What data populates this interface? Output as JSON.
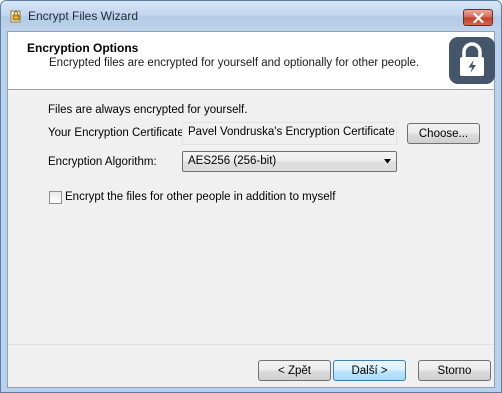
{
  "window": {
    "title": "Encrypt Files Wizard",
    "icons": {
      "app": "encrypt-wizard-icon",
      "close": "close-icon"
    }
  },
  "header": {
    "title": "Encryption Options",
    "subtitle": "Encrypted files are encrypted for yourself and optionally for other people.",
    "icon": "lock-icon"
  },
  "form": {
    "note": "Files are always encrypted for yourself.",
    "certificate_label": "Your Encryption Certificate:",
    "certificate_value": "Pavel Vondruska's Encryption Certificate",
    "choose_label": "Choose...",
    "algorithm_label": "Encryption Algorithm:",
    "algorithm_value": "AES256 (256-bit)",
    "others_checkbox_label": "Encrypt the files for other people in addition to myself",
    "others_checked": false
  },
  "footer": {
    "back_label": "< Zpět",
    "next_label": "Další >",
    "cancel_label": "Storno"
  },
  "colors": {
    "accent": "#3c7fb1",
    "lock_tile": "#45566a",
    "close": "#c3422a"
  }
}
